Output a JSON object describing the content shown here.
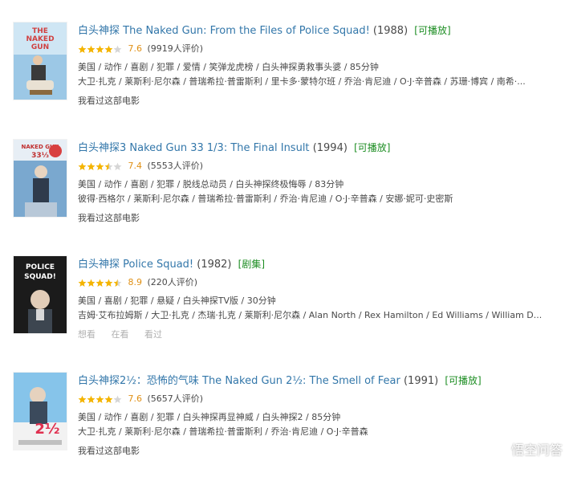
{
  "colors": {
    "title_link": "#3377aa",
    "play_tag": "#1c8d22",
    "score": "#e09015",
    "star_on": "#f4b400",
    "star_off": "#d6d6d6",
    "muted": "#b0b0b0"
  },
  "movies": [
    {
      "title": "白头神探 The Naked Gun: From the Files of Police Squad!",
      "year": "(1988)",
      "tag": "[可播放]",
      "rating": 7.6,
      "stars": 4,
      "score_text": "7.6",
      "count_text": "(9919人评价)",
      "genres": "美国 / 动作 / 喜剧 / 犯罪 / 爱情 / 笑弹龙虎榜 / 白头神探勇救事头婆 / 85分钟",
      "people": "大卫·扎克 / 莱斯利·尼尔森 / 普瑞希拉·普雷斯利 / 里卡多·蒙特尔班 / 乔治·肯尼迪 / O·J·辛普森 / 苏珊·博宾 / 南希·...",
      "actions": [
        "我看过这部电影"
      ],
      "poster": {
        "icon": "poster-naked-gun-1",
        "colors": [
          "#8fbfe0",
          "#d9ecf6",
          "#444444"
        ]
      }
    },
    {
      "title": "白头神探3 Naked Gun 33 1/3: The Final Insult",
      "year": "(1994)",
      "tag": "[可播放]",
      "rating": 7.4,
      "stars": 3.5,
      "score_text": "7.4",
      "count_text": "(5553人评价)",
      "genres": "美国 / 动作 / 喜剧 / 犯罪 / 脱线总动员 / 白头神探终极悔辱 / 83分钟",
      "people": "彼得·西格尔 / 莱斯利·尼尔森 / 普瑞希拉·普雷斯利 / 乔治·肯尼迪 / O·J·辛普森 / 安娜·妮可·史密斯",
      "actions": [
        "我看过这部电影"
      ],
      "poster": {
        "icon": "poster-naked-gun-3",
        "colors": [
          "#6f9fc8",
          "#e8d8c8",
          "#c03030"
        ]
      }
    },
    {
      "title": "白头神探 Police Squad!",
      "year": "(1982)",
      "tag": "[剧集]",
      "rating": 8.9,
      "stars": 4.5,
      "score_text": "8.9",
      "count_text": "(220人评价)",
      "genres": "美国 / 喜剧 / 犯罪 / 悬疑 / 白头神探TV版 / 30分钟",
      "people": "吉姆·艾布拉姆斯 / 大卫·扎克 / 杰瑞·扎克 / 莱斯利·尼尔森 / Alan North / Rex Hamilton / Ed Williams / William D...",
      "actions": [
        "想看",
        "在看",
        "看过"
      ],
      "poster": {
        "icon": "poster-police-squad",
        "colors": [
          "#1a1a1a",
          "#ffffff",
          "#d02020"
        ]
      }
    },
    {
      "title": "白头神探2½：恐怖的气味 The Naked Gun 2½: The Smell of Fear",
      "year": "(1991)",
      "tag": "[可播放]",
      "rating": 7.6,
      "stars": 4,
      "score_text": "7.6",
      "count_text": "(5657人评价)",
      "genres": "美国 / 动作 / 喜剧 / 犯罪 / 白头神探再显神威 / 白头神探2 / 85分钟",
      "people": "大卫·扎克 / 莱斯利·尼尔森 / 普瑞希拉·普雷斯利 / 乔治·肯尼迪 / O·J·辛普森",
      "actions": [
        "我看过这部电影"
      ],
      "poster": {
        "icon": "poster-naked-gun-2-5",
        "colors": [
          "#7fc0e8",
          "#ffffff",
          "#e03050"
        ]
      }
    }
  ],
  "watermark": {
    "text": "悟空问答",
    "icon": "wukong-logo-icon"
  }
}
